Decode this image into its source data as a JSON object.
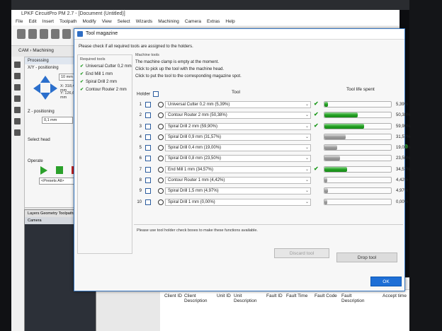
{
  "app": {
    "title": "LPKF CircuitPro PM 2.7 - [Document (Untitled)]",
    "menu": [
      "File",
      "Edit",
      "Insert",
      "Toolpath",
      "Modify",
      "View",
      "Select",
      "Wizards",
      "Machining",
      "Camera",
      "Extras",
      "Help"
    ],
    "cam_row": "CAM  ›  Machining",
    "left_panel": {
      "header": "Processing",
      "positioning": "X/Y - positioning",
      "step_value": "10 mm",
      "x_value": "X:  318,429 mm",
      "y_value": "Y:  126,679 mm",
      "z_label": "Z - positioning",
      "z_value": "0,1 mm",
      "select_head": "Select head",
      "operate": "Operate",
      "presets": "<Presets All>"
    },
    "viewport": {
      "tabs": "Layers  Geometry  Toolpaths",
      "label": "Camera"
    },
    "bottom_list": {
      "columns": [
        "Client ID",
        "Client Description",
        "Unit ID",
        "Unit Description",
        "Fault ID",
        "Fault Time",
        "Fault Code",
        "Fault Description",
        "Accept time"
      ]
    }
  },
  "dialog": {
    "title": "Tool magazine",
    "intro": "Please check if all required tools are assigned to the holders.",
    "required_title": "Required tools",
    "required_tools": [
      "Universal Cutter 0,2 mm",
      "End Mill 1 mm",
      "Spiral Drill  2 mm",
      "Contour Router 2 mm"
    ],
    "machine_tools": {
      "title": "Machine tools",
      "clamp_status": "The machine clamp is empty at the moment.",
      "pick_text": "Click      to pick up the tool with the machine head.",
      "put_text": "Click      to put the tool to the corresponding magazine spot."
    },
    "table": {
      "holder_header": "Holder",
      "tool_header": "Tool",
      "life_header": "Tool life spent",
      "rows": [
        {
          "holder": "1",
          "tool": "Universal Cutter 0,2 mm (5,39%)",
          "required": true,
          "life": 5.39,
          "life_text": "5,39%",
          "bar_color": "green"
        },
        {
          "holder": "2",
          "tool": "Contour Router 2 mm (50,38%)",
          "required": true,
          "life": 50.38,
          "life_text": "50,38%",
          "bar_color": "green"
        },
        {
          "holder": "3",
          "tool": "Spiral Drill  2 mm (59,90%)",
          "required": true,
          "life": 59.9,
          "life_text": "59,90%",
          "bar_color": "green"
        },
        {
          "holder": "4",
          "tool": "Spiral Drill  0,9 mm (31,57%)",
          "required": false,
          "life": 31.57,
          "life_text": "31,57%",
          "bar_color": "grey"
        },
        {
          "holder": "5",
          "tool": "Spiral Drill  0,4 mm (19,00%)",
          "required": false,
          "life": 19.0,
          "life_text": "19,00%",
          "bar_color": "grey"
        },
        {
          "holder": "6",
          "tool": "Spiral Drill  0,8 mm (23,50%)",
          "required": false,
          "life": 23.5,
          "life_text": "23,50%",
          "bar_color": "grey"
        },
        {
          "holder": "7",
          "tool": "End Mill 1 mm (34,57%)",
          "required": true,
          "life": 34.57,
          "life_text": "34,57%",
          "bar_color": "green"
        },
        {
          "holder": "8",
          "tool": "Contour Router 1 mm (4,42%)",
          "required": false,
          "life": 4.42,
          "life_text": "4,42%",
          "bar_color": "grey"
        },
        {
          "holder": "9",
          "tool": "Spiral Drill  1,5 mm (4,97%)",
          "required": false,
          "life": 4.97,
          "life_text": "4,97%",
          "bar_color": "grey"
        },
        {
          "holder": "10",
          "tool": "Spiral Drill  1 mm (0,00%)",
          "required": false,
          "life": 0.0,
          "life_text": "0,00%",
          "bar_color": "grey"
        }
      ]
    },
    "note": "Please use tool holder check boxes to make these functions available.",
    "buttons": {
      "discard": "Discard tool",
      "drop": "Drop tool",
      "ok": "OK"
    }
  },
  "colors": {
    "accent": "#1e6fd6",
    "ok_check": "#1e9a1e",
    "bar_green": "#23a023",
    "bar_grey": "#9a9a9a"
  }
}
